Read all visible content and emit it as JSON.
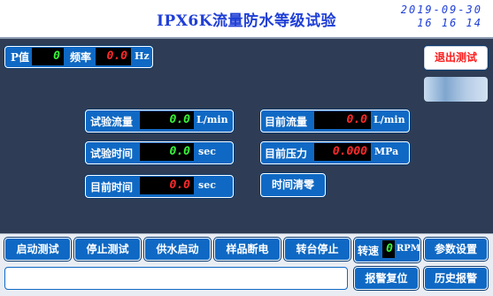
{
  "header": {
    "title": "IPX6K流量防水等级试验",
    "date": "2019-09-30",
    "time": "16 16 14"
  },
  "status_top": {
    "p_label": "P值",
    "p_value": "0",
    "freq_label": "频率",
    "freq_value": "0.0",
    "freq_unit": "Hz"
  },
  "exit_button": "退出测试",
  "readings": {
    "test_flow": {
      "label": "试验流量",
      "value": "0.0",
      "unit": "L/min"
    },
    "test_time": {
      "label": "试验时间",
      "value": "0.0",
      "unit": "sec"
    },
    "current_time": {
      "label": "目前时间",
      "value": "0.0",
      "unit": "sec"
    },
    "current_flow": {
      "label": "目前流量",
      "value": "0.0",
      "unit": "L/min"
    },
    "current_pressure": {
      "label": "目前压力",
      "value": "0.000",
      "unit": "MPa"
    }
  },
  "time_clear_button": "时间清零",
  "bottom_bar": {
    "start_test": "启动测试",
    "stop_test": "停止测试",
    "water_start": "供水启动",
    "sample_power_off": "样品断电",
    "turntable_stop": "转台停止",
    "speed_label": "转速",
    "speed_value": "0",
    "speed_unit": "RPM",
    "param_settings": "参数设置",
    "alarm_reset": "报警复位",
    "history_alarm": "历史报警"
  },
  "colors": {
    "background": "#2e3d55",
    "panel_blue": "#0f69c4",
    "title_blue": "#1f3fd6",
    "digit_green": "#38f53a",
    "digit_red": "#ff2a2a"
  }
}
